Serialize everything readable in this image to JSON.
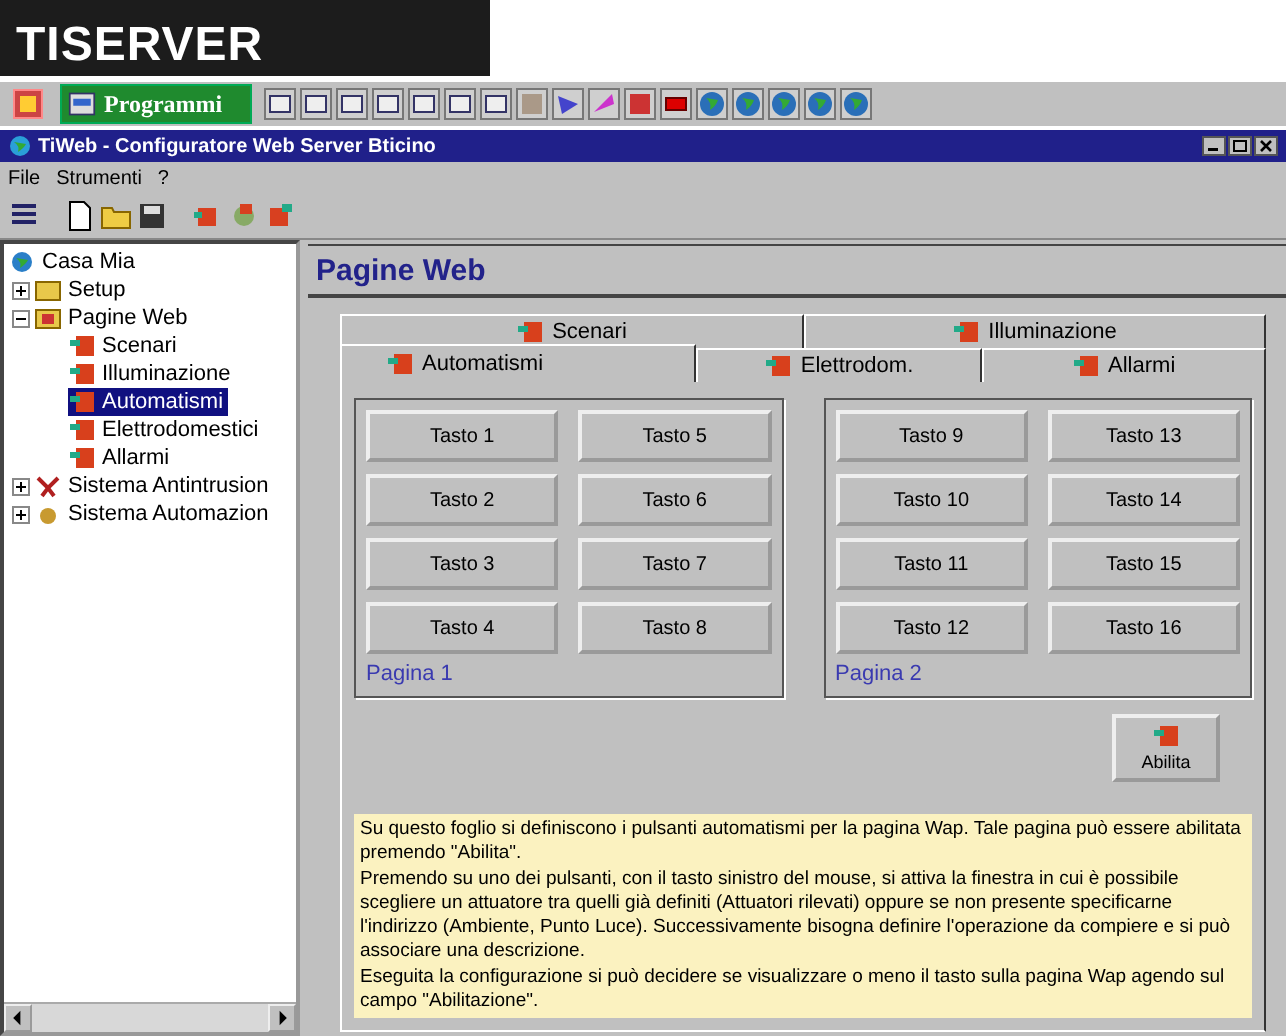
{
  "header": {
    "title": "TISERVER"
  },
  "taskbar": {
    "label": "Programmi"
  },
  "window": {
    "title": "TiWeb - Configuratore  Web Server Bticino"
  },
  "menu": [
    "File",
    "Strumenti",
    "?"
  ],
  "tree": [
    {
      "label": "Casa Mia",
      "kind": "globe",
      "selected": false,
      "children": [
        {
          "label": "Setup",
          "kind": "folder",
          "expanded": false,
          "selected": false
        },
        {
          "label": "Pagine Web",
          "kind": "webfolder",
          "expanded": true,
          "selected": false,
          "children": [
            {
              "label": "Scenari",
              "kind": "page",
              "selected": false
            },
            {
              "label": "Illuminazione",
              "kind": "page",
              "selected": false
            },
            {
              "label": "Automatismi",
              "kind": "page",
              "selected": true
            },
            {
              "label": "Elettrodomestici",
              "kind": "page",
              "selected": false
            },
            {
              "label": "Allarmi",
              "kind": "page",
              "selected": false
            }
          ]
        },
        {
          "label": "Sistema Antintrusion",
          "kind": "alarm",
          "expanded": false,
          "selected": false
        },
        {
          "label": "Sistema Automazion",
          "kind": "automation",
          "expanded": false,
          "selected": false
        }
      ]
    }
  ],
  "panel": {
    "title": "Pagine Web"
  },
  "tab_rows": [
    [
      {
        "label": "Scenari",
        "selected": false
      },
      {
        "label": "Illuminazione",
        "selected": false
      }
    ],
    [
      {
        "label": "Automatismi",
        "selected": true
      },
      {
        "label": "Elettrodom.",
        "selected": false
      },
      {
        "label": "Allarmi",
        "selected": false
      }
    ]
  ],
  "pages": [
    {
      "caption": "Pagina 1",
      "buttons": [
        "Tasto 1",
        "Tasto 5",
        "Tasto 2",
        "Tasto 6",
        "Tasto 3",
        "Tasto 7",
        "Tasto 4",
        "Tasto 8"
      ]
    },
    {
      "caption": "Pagina 2",
      "buttons": [
        "Tasto 9",
        "Tasto 13",
        "Tasto 10",
        "Tasto 14",
        "Tasto 11",
        "Tasto 15",
        "Tasto 12",
        "Tasto 16"
      ]
    }
  ],
  "enable_button": {
    "label": "Abilita"
  },
  "help": [
    "Su questo foglio si definiscono i pulsanti automatismi per la pagina Wap. Tale pagina può essere abilitata premendo \"Abilita\".",
    "Premendo su uno dei pulsanti, con il tasto sinistro del mouse, si attiva la finestra in cui è possibile scegliere un attuatore tra quelli già definiti (Attuatori rilevati) oppure se non presente specificarne l'indirizzo (Ambiente, Punto Luce). Successivamente bisogna definire l'operazione da compiere e si può associare una descrizione.",
    "Eseguita la configurazione si può decidere se visualizzare o meno il tasto sulla pagina Wap agendo sul campo \"Abilitazione\"."
  ]
}
